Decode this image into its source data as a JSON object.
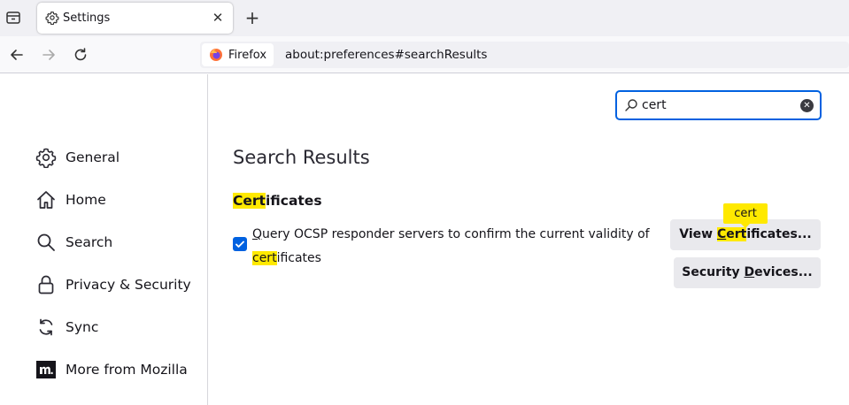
{
  "browser": {
    "tab": {
      "title": "Settings",
      "close": "✕"
    },
    "new_tab": "+",
    "identity_label": "Firefox",
    "url": "about:preferences#searchResults"
  },
  "sidebar": {
    "items": [
      {
        "label": "General",
        "icon": "gear-icon"
      },
      {
        "label": "Home",
        "icon": "home-icon"
      },
      {
        "label": "Search",
        "icon": "search-icon"
      },
      {
        "label": "Privacy & Security",
        "icon": "lock-icon"
      },
      {
        "label": "Sync",
        "icon": "sync-icon"
      },
      {
        "label": "More from Mozilla",
        "icon": "mozilla-icon"
      }
    ]
  },
  "search": {
    "value": "cert",
    "clear": "✕"
  },
  "main": {
    "heading": "Search Results",
    "section": {
      "title_match": "Cert",
      "title_rest": "ificates"
    },
    "option": {
      "checked": true,
      "text_q": "Q",
      "text_1": "uery OCSP responder servers to confirm the current validity of ",
      "text_match": "cert",
      "text_2": "ificates"
    },
    "view_button": {
      "pre": "View ",
      "accesskey": "C",
      "match_rest": "ert",
      "post": "ificates..."
    },
    "security_button": {
      "pre": "Security ",
      "accesskey": "D",
      "post": "evices..."
    },
    "tooltip": "cert"
  },
  "colors": {
    "highlight": "#ffe900",
    "accent": "#0061e0"
  }
}
